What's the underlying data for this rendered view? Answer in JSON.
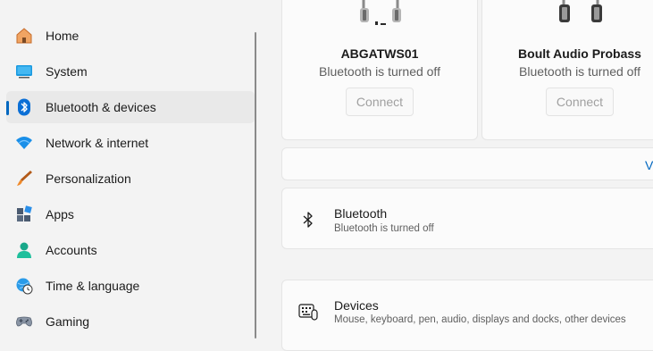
{
  "sidebar": {
    "items": [
      {
        "label": "Home",
        "icon": "home-icon"
      },
      {
        "label": "System",
        "icon": "system-icon"
      },
      {
        "label": "Bluetooth & devices",
        "icon": "bluetooth-icon",
        "selected": true
      },
      {
        "label": "Network & internet",
        "icon": "wifi-icon"
      },
      {
        "label": "Personalization",
        "icon": "brush-icon"
      },
      {
        "label": "Apps",
        "icon": "apps-icon"
      },
      {
        "label": "Accounts",
        "icon": "person-icon"
      },
      {
        "label": "Time & language",
        "icon": "globe-clock-icon"
      },
      {
        "label": "Gaming",
        "icon": "gamepad-icon"
      }
    ]
  },
  "devices": [
    {
      "name": "ABGATWS01",
      "status": "Bluetooth is turned off",
      "button": "Connect"
    },
    {
      "name": "Boult Audio Probass",
      "status": "Bluetooth is turned off",
      "button": "Connect"
    }
  ],
  "view_more": {
    "label": "V"
  },
  "bluetooth_row": {
    "title": "Bluetooth",
    "subtitle": "Bluetooth is turned off"
  },
  "devices_row": {
    "title": "Devices",
    "subtitle": "Mouse, keyboard, pen, audio, displays and docks, other devices"
  },
  "colors": {
    "accent": "#0067c0",
    "background": "#f3f3f3",
    "card": "#fbfbfb"
  }
}
